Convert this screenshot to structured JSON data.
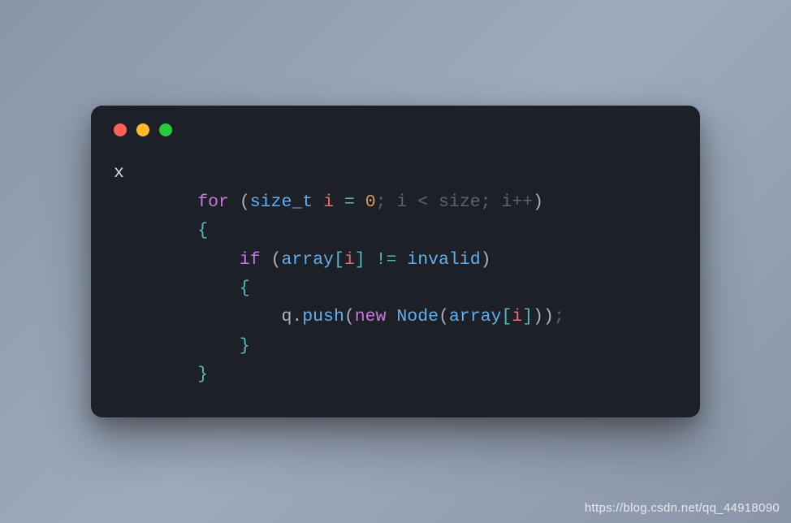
{
  "window": {
    "traffic": {
      "red": "close",
      "yellow": "minimize",
      "green": "maximize"
    }
  },
  "code": {
    "marker": "x",
    "line1": {
      "for": "for",
      "paren_open": " (",
      "type": "size_t",
      "var": " i",
      "assign": " = ",
      "zero": "0",
      "semi1": ";",
      "cond": " i < size;",
      "incr": " i++",
      "paren_close": ")"
    },
    "line2": {
      "brace_open": "{"
    },
    "line3": {
      "if": "if",
      "paren_open": " (",
      "array": "array",
      "bracket_open": "[",
      "idx": "i",
      "bracket_close": "]",
      "neq": " != ",
      "invalid": "invalid",
      "paren_close": ")"
    },
    "line4": {
      "brace_open": "{"
    },
    "line5": {
      "q": "q",
      "dot": ".",
      "push": "push",
      "paren_open": "(",
      "new": "new",
      "space": " ",
      "node": "Node",
      "paren_open2": "(",
      "array": "array",
      "bracket_open": "[",
      "idx": "i",
      "bracket_close": "]",
      "paren_close2": ")",
      "paren_close": ")",
      "semi": ";"
    },
    "line6": {
      "brace_close": "}"
    },
    "line7": {
      "brace_close": "}"
    }
  },
  "watermark": "https://blog.csdn.net/qq_44918090"
}
